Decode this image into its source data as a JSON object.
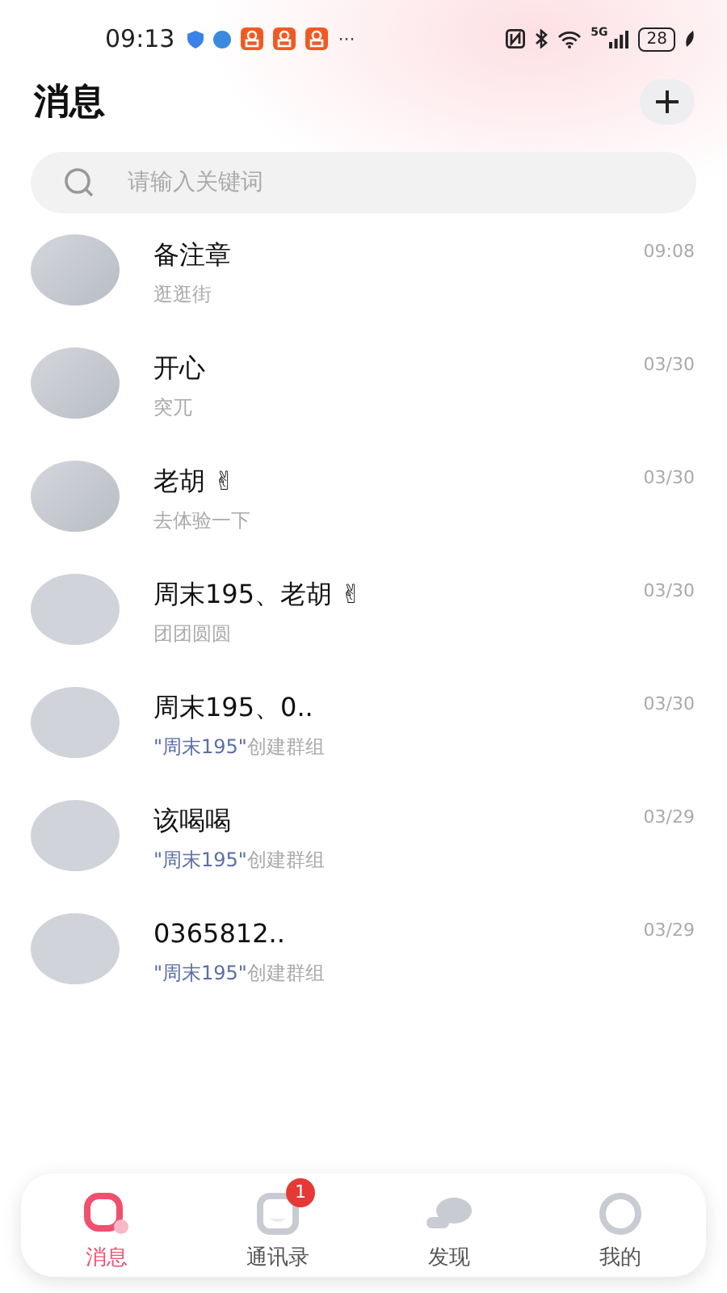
{
  "status_bar": {
    "time": "09:13",
    "more": "···",
    "network": "5G",
    "battery": "28"
  },
  "header": {
    "title": "消息"
  },
  "search": {
    "placeholder": "请输入关键词"
  },
  "conversations": [
    {
      "name": "备注章",
      "preview": "逛逛街",
      "time": "09:08",
      "kind": "photo"
    },
    {
      "name": "开心",
      "preview": "突兀",
      "time": "03/30",
      "kind": "photo"
    },
    {
      "name": "老胡 ✌",
      "preview": "去体验一下",
      "time": "03/30",
      "kind": "photo"
    },
    {
      "name": "周末195、老胡 ✌",
      "preview": "团团圆圆",
      "time": "03/30",
      "kind": "blank"
    },
    {
      "name": "周末195、0..",
      "mention": "\"周末195\"",
      "preview": "创建群组",
      "time": "03/30",
      "kind": "blank"
    },
    {
      "name": "该喝喝",
      "mention": "\"周末195\"",
      "preview": "创建群组",
      "time": "03/29",
      "kind": "blank"
    },
    {
      "name": "0365812..",
      "mention": "\"周末195\"",
      "preview": "创建群组",
      "time": "03/29",
      "kind": "blank"
    }
  ],
  "tabs": [
    {
      "label": "消息",
      "kind": "messages",
      "selected": true
    },
    {
      "label": "通讯录",
      "kind": "contacts",
      "selected": false,
      "badge": "1"
    },
    {
      "label": "发现",
      "kind": "discover",
      "selected": false
    },
    {
      "label": "我的",
      "kind": "profile",
      "selected": false
    }
  ]
}
